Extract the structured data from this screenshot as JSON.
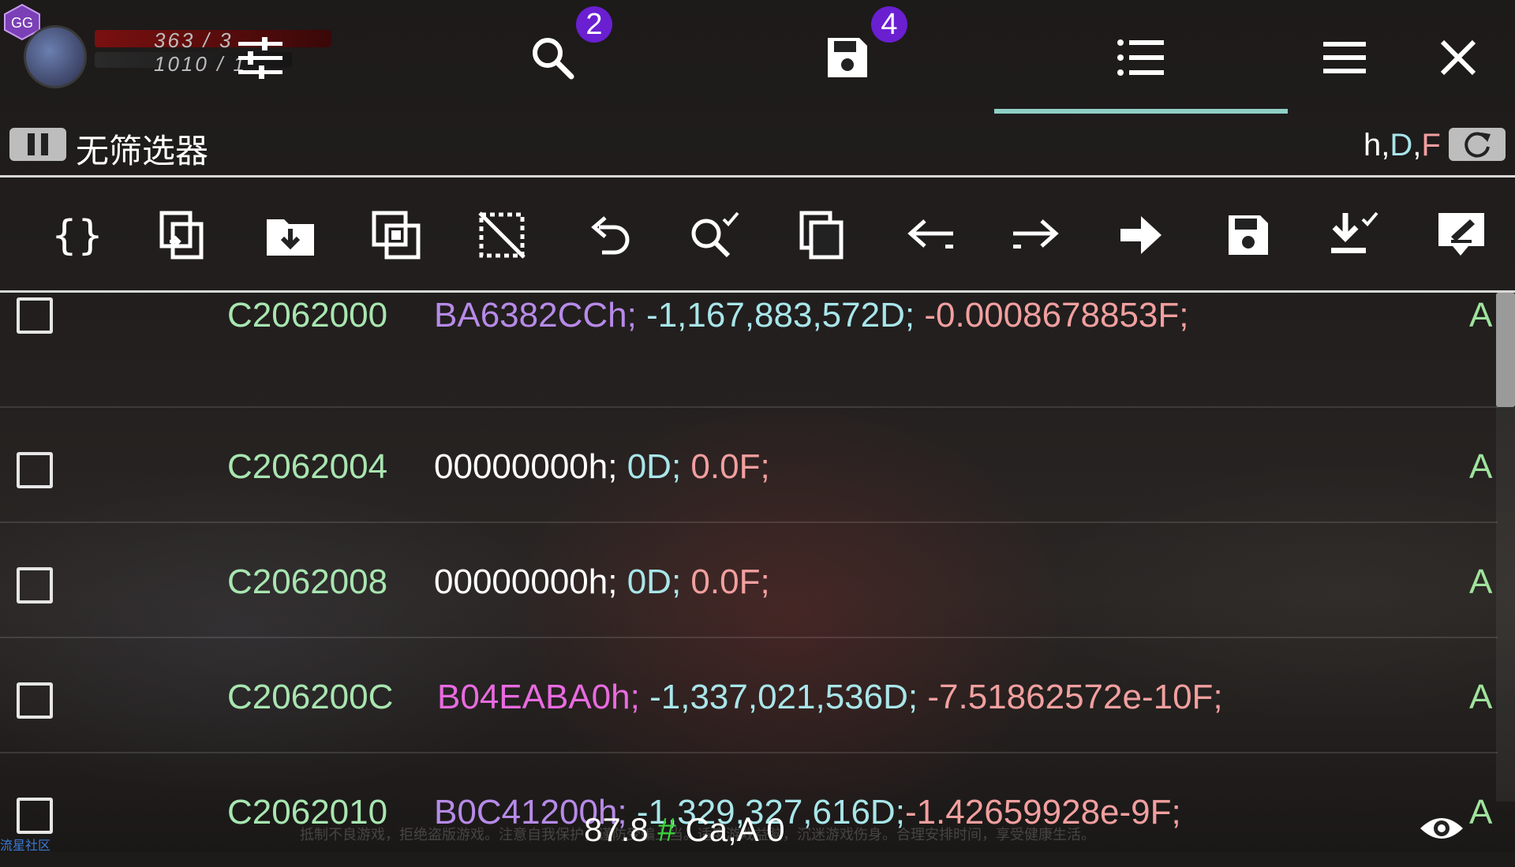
{
  "app": {
    "logo_text": "GG",
    "hud_hp": "363 / 3",
    "hud_mp": "1010 / 1"
  },
  "toolbar_top": {
    "search_badge": "2",
    "saved_badge": "4"
  },
  "filter": {
    "label": "无筛选器",
    "types_h": "h",
    "types_d": "D",
    "types_f": "F",
    "types_sep": ","
  },
  "tools": [
    "edit-values-icon",
    "copy-icon",
    "load-list-icon",
    "select-icon",
    "deselect-icon",
    "undo-icon",
    "search-check-icon",
    "duplicate-icon",
    "back-icon",
    "forward-icon",
    "goto-icon",
    "save-icon",
    "import-icon",
    "edit-selected-icon"
  ],
  "rows": [
    {
      "address": "C2062000",
      "hex": "BA6382CCh;",
      "hex_color": "purple",
      "dword": "-1,167,883,572D;",
      "float": "-0.0008678853F;",
      "flag": "A"
    },
    {
      "address": "C2062004",
      "hex": "00000000h;",
      "hex_color": "white",
      "dword": "0D;",
      "float": "0.0F;",
      "flag": "A"
    },
    {
      "address": "C2062008",
      "hex": "00000000h;",
      "hex_color": "white",
      "dword": "0D;",
      "float": "0.0F;",
      "flag": "A"
    },
    {
      "address": "C206200C",
      "hex": "B04EABA0h;",
      "hex_color": "pink",
      "dword": "-1,337,021,536D;",
      "float": "-7.51862572e-10F;",
      "flag": "A"
    },
    {
      "address": "C2062010",
      "hex": "B0C41200h;",
      "hex_color": "purple",
      "dword": "-1,329,327,616D;",
      "float": "-1.42659928e-9F;",
      "flag": "A"
    }
  ],
  "status": {
    "speed": "87.8",
    "hash": "#",
    "regions": "Ca,A",
    "count": "0"
  },
  "footer": {
    "community": "流星社区",
    "notice": "抵制不良游戏，拒绝盗版游戏。注意自我保护，谨防受骗上当。适度游戏益脑，沉迷游戏伤身。合理安排时间，享受健康生活。"
  },
  "colors": {
    "accent_tab": "#8fcfc6",
    "badge": "#6a1fd1",
    "address": "#a8e6b0",
    "dword": "#a8e6ea",
    "float": "#f29f9f"
  }
}
